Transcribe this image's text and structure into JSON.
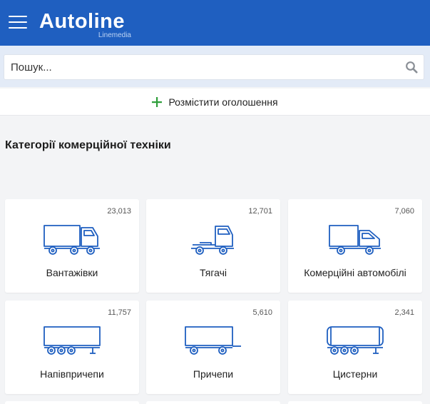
{
  "header": {
    "menu_icon": "hamburger-menu-icon",
    "logo_text": "Autoline",
    "logo_subtext": "Linemedia",
    "background_color": "#1f5fc0"
  },
  "search": {
    "placeholder": "Пошук...",
    "value": "",
    "icon": "search-icon"
  },
  "post_ad": {
    "icon": "plus-icon",
    "label": "Розмістити оголошення",
    "icon_color": "#2e9e3a"
  },
  "categories": {
    "title": "Категорії комерційної техніки",
    "icon_color": "#1f5fc0",
    "items": [
      {
        "label": "Вантажівки",
        "count": "23,013",
        "icon": "truck-icon"
      },
      {
        "label": "Тягачі",
        "count": "12,701",
        "icon": "tractor-unit-icon"
      },
      {
        "label": "Комерційні автомобілі",
        "count": "7,060",
        "icon": "van-icon"
      },
      {
        "label": "Напівпричепи",
        "count": "11,757",
        "icon": "semi-trailer-icon"
      },
      {
        "label": "Причепи",
        "count": "5,610",
        "icon": "trailer-icon"
      },
      {
        "label": "Цистерни",
        "count": "2,341",
        "icon": "tanker-icon"
      }
    ]
  }
}
